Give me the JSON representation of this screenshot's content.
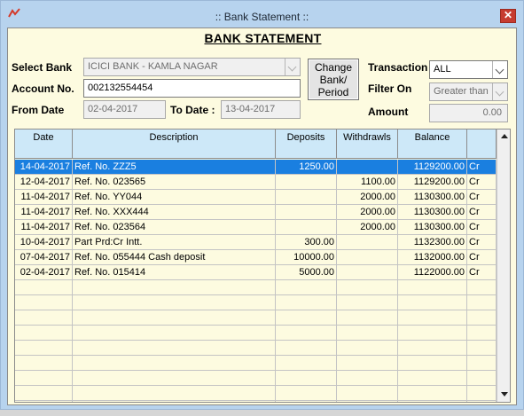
{
  "window": {
    "title": ":: Bank Statement ::",
    "close_label": "✕"
  },
  "heading": "BANK STATEMENT",
  "form": {
    "select_bank_label": "Select Bank",
    "select_bank_value": "ICICI BANK - KAMLA NAGAR",
    "account_no_label": "Account No.",
    "account_no_value": "002132554454",
    "from_date_label": "From Date",
    "from_date_value": "02-04-2017",
    "to_date_label": "To Date :",
    "to_date_value": "13-04-2017",
    "change_button": [
      "Change",
      "Bank/",
      "Period"
    ],
    "transaction_label": "Transaction",
    "transaction_value": "ALL",
    "filter_on_label": "Filter On",
    "filter_on_value": "Greater than",
    "amount_label": "Amount",
    "amount_value": "0.00"
  },
  "grid": {
    "columns": [
      "Date",
      "Description",
      "Deposits",
      "Withdrawls",
      "Balance",
      ""
    ],
    "selected_row": 0,
    "rows": [
      [
        "14-04-2017",
        "Ref. No. ZZZ5",
        "1250.00",
        "",
        "1129200.00",
        "Cr"
      ],
      [
        "12-04-2017",
        "Ref. No. 023565",
        "",
        "1100.00",
        "1129200.00",
        "Cr"
      ],
      [
        "11-04-2017",
        "Ref. No. YY044",
        "",
        "2000.00",
        "1130300.00",
        "Cr"
      ],
      [
        "11-04-2017",
        "Ref. No. XXX444",
        "",
        "2000.00",
        "1130300.00",
        "Cr"
      ],
      [
        "11-04-2017",
        "Ref. No. 023564",
        "",
        "2000.00",
        "1130300.00",
        "Cr"
      ],
      [
        "10-04-2017",
        "Part Prd:Cr Intt.",
        "300.00",
        "",
        "1132300.00",
        "Cr"
      ],
      [
        "07-04-2017",
        "Ref. No. 055444 Cash deposit",
        "10000.00",
        "",
        "1132000.00",
        "Cr"
      ],
      [
        "02-04-2017",
        "Ref. No. 015414",
        "5000.00",
        "",
        "1122000.00",
        "Cr"
      ]
    ],
    "empty_rows": 9
  },
  "colors": {
    "accent": "#1a7fe0",
    "header_bg": "#cde8f8",
    "body_bg": "#fdfbe0",
    "window_bg": "#b7d3ee"
  }
}
